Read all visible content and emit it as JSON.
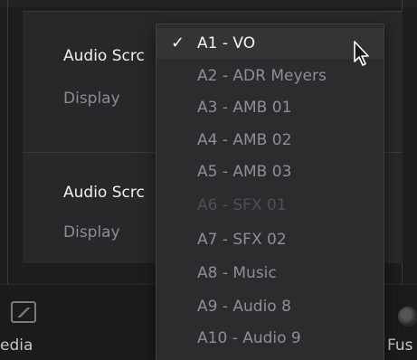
{
  "settings": {
    "rows": [
      {
        "title": "Audio Scrc",
        "subtitle": "Display"
      },
      {
        "title": "Audio Scrc",
        "subtitle": "Display"
      }
    ]
  },
  "dropdown": {
    "items": [
      {
        "label": "A1 - VO",
        "selected": true
      },
      {
        "label": "A2 - ADR Meyers"
      },
      {
        "label": "A3 - AMB 01"
      },
      {
        "label": "A4 - AMB 02"
      },
      {
        "label": "A5 - AMB 03"
      },
      {
        "label": "A6 - SFX 01",
        "disabled": true
      },
      {
        "label": "A7 - SFX 02"
      },
      {
        "label": "A8 - Music"
      },
      {
        "label": "A9 - Audio 8"
      },
      {
        "label": "A10 - Audio 9"
      }
    ]
  },
  "bottom_bar": {
    "media_label": "edia",
    "fusion_label": "Fus"
  },
  "icons": {
    "check": "checkmark-icon",
    "cursor": "mouse-pointer-icon",
    "media": "media-page-icon",
    "fusion": "fusion-page-icon"
  }
}
